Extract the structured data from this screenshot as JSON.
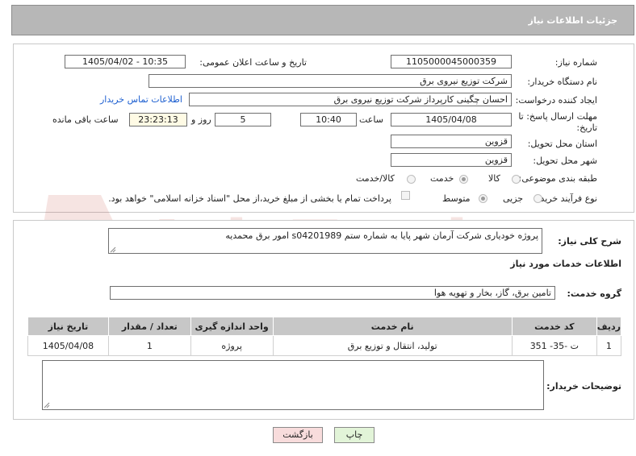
{
  "header": {
    "title": "جزئیات اطلاعات نیاز"
  },
  "form": {
    "need_number": {
      "label": "شماره نیاز:",
      "value": "1105000045000359"
    },
    "announce_datetime": {
      "label": "تاریخ و ساعت اعلان عمومی:",
      "value": "1405/04/02 - 10:35"
    },
    "buyer_org": {
      "label": "نام دستگاه خریدار:",
      "value": "شرکت توزیع نیروی برق"
    },
    "creator": {
      "label": "ایجاد کننده درخواست:",
      "value": "احسان چگینی کارپرداز شرکت توزیع نیروی برق",
      "contact_link": "اطلاعات تماس خریدار"
    },
    "deadline": {
      "label_line1": "مهلت ارسال پاسخ: تا",
      "label_line2": "تاریخ:",
      "date": "1405/04/08",
      "time_label": "ساعت",
      "time": "10:40",
      "days": "5",
      "days_label": "روز و",
      "remaining": "23:23:13",
      "remaining_label": "ساعت باقی مانده"
    },
    "delivery_province": {
      "label": "استان محل تحویل:",
      "value": "قزوین"
    },
    "delivery_city": {
      "label": "شهر محل تحویل:",
      "value": "قزوین"
    },
    "category": {
      "label": "طبقه بندی موضوعی:",
      "options": [
        "کالا",
        "خدمت",
        "کالا/خدمت"
      ],
      "selected": "خدمت"
    },
    "process_type": {
      "label": "نوع فرآیند خرید :",
      "options": [
        "جزیی",
        "متوسط"
      ],
      "selected": "متوسط",
      "treasury_note": "پرداخت تمام یا بخشی از مبلغ خرید،از محل \"اسناد خزانه اسلامی\" خواهد بود."
    }
  },
  "description": {
    "label": "شرح کلی نیاز:",
    "value": "پروژه خودیاری شرکت آرمان شهر پایا به شماره ستم s04201989 امور برق محمدیه"
  },
  "services_section": {
    "title": "اطلاعات خدمات مورد نیاز",
    "group_label": "گروه خدمت:",
    "group_value": "تامین برق، گاز، بخار و تهویه هوا",
    "table": {
      "headers": [
        "ردیف",
        "کد خدمت",
        "نام خدمت",
        "واحد اندازه گیری",
        "تعداد / مقدار",
        "تاریخ نیاز"
      ],
      "rows": [
        [
          "1",
          "ت -35- 351",
          "تولید، انتقال و توزیع برق",
          "پروژه",
          "1",
          "1405/04/08"
        ]
      ]
    }
  },
  "buyer_notes": {
    "label": "توضیحات خریدار:",
    "value": ""
  },
  "buttons": {
    "print": "چاپ",
    "back": "بازگشت"
  },
  "watermark": {
    "text": "AriaTender.net",
    "color": "#c0392b"
  },
  "colors": {
    "header_bg": "#b7b7b7",
    "print_btn": "#e2f4d8",
    "back_btn": "#f8dcdc",
    "link": "#1d5fd0"
  }
}
